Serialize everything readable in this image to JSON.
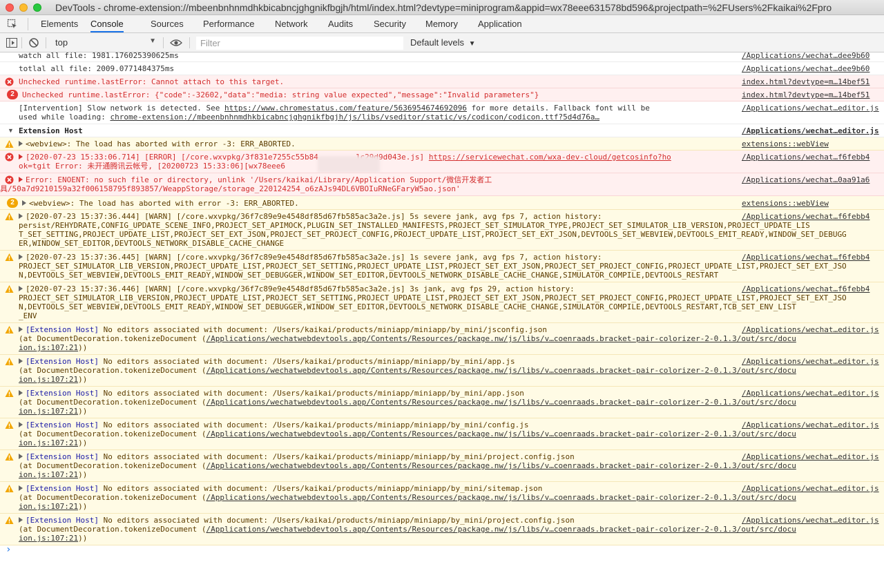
{
  "window": {
    "title": "DevTools - chrome-extension://mbeenbnhnmdhkbicabncjghgnikfbgjh/html/index.html?devtype=miniprogram&appid=wx78eee631578bd596&projectpath=%2FUsers%2Fkaikai%2Fpro"
  },
  "tabs": [
    "Elements",
    "Console",
    "Sources",
    "Performance",
    "Network",
    "Audits",
    "Security",
    "Memory",
    "Application"
  ],
  "active_tab": "Console",
  "toolbar": {
    "context": "top",
    "filter_placeholder": "Filter",
    "levels": "Default levels"
  },
  "colors": {
    "error": "#d32f2f",
    "warn": "#f2a600",
    "accent": "#1a73e8",
    "link_blue": "#1a1aa6"
  },
  "messages": {
    "m0": {
      "line1": "watch all file: 1981.176025390625ms",
      "src": "/Applications/wechat…dee9b60"
    },
    "m1": {
      "line1": "totlal all file: 2009.0771484375ms",
      "src": "/Applications/wechat…dee9b60"
    },
    "m2": {
      "line1": "Unchecked runtime.lastError: Cannot attach to this target.",
      "src": "index.html?devtype=m…14bef51"
    },
    "m3": {
      "badge": "2",
      "line1": "Unchecked runtime.lastError: {\"code\":-32602,\"data\":\"media: string value expected\",\"message\":\"Invalid parameters\"}",
      "src": "index.html?devtype=m…14bef51"
    },
    "m4": {
      "line1_pre": "[Intervention] Slow network is detected. See ",
      "line1_link": "https://www.chromestatus.com/feature/5636954674692096",
      "line1_post": " for more details. Fallback font will be",
      "line2_pre": "used while loading: ",
      "line2_link": "chrome-extension://mbeenbnhnmdhkbicabncjghgnikfbgjh/js/libs/vseditor/static/vs/codicon/codicon.ttf?5d4d76a…",
      "src": "/Applications/wechat…editor.js"
    },
    "m5": {
      "label": "Extension Host",
      "src": "/Applications/wechat…editor.js"
    },
    "m6": {
      "line1": "<webview>: The load has aborted with error -3: ERR_ABORTED.",
      "src": "extensions::webView"
    },
    "m7": {
      "line1_pre": "[2020-07-23 15:33:06.714] [ERROR] [/core.wxvpkg/3f831e7255c55b84",
      "line1_mid": "1c29d9d043e.js] ",
      "line1_link": "https://servicewechat.com/wxa-dev-cloud/getcosinfo?ho",
      "line2": "ok=tgit Error: 未开通腾讯云帐号, [20200723 15:33:06][wx78eee6",
      "src": "/Applications/wechat…f6febb4"
    },
    "m8": {
      "line1": "Error: ENOENT: no such file or directory, unlink '/Users/kaikai/Library/Application Support/微信开发者工",
      "line2": "具/50a7d9210159a32f006158795f893857/WeappStorage/storage_220124254_o6zAJs94DL6VBOIuRNeGFaryW5ao.json'",
      "src": "/Applications/wechat…0aa91a6"
    },
    "m9": {
      "badge": "2",
      "line1": "<webview>: The load has aborted with error -3: ERR_ABORTED.",
      "src": "extensions::webView"
    },
    "m10": {
      "line1": "[2020-07-23 15:37:36.444] [WARN] [/core.wxvpkg/36f7c89e9e4548df85d67fb585ac3a2e.js] 5s severe jank, avg fps 7, action history:",
      "line2": "persist/REHYDRATE,CONFIG_UPDATE_SCENE_INFO,PROJECT_SET_APIMOCK,PLUGIN_SET_INSTALLED_MANIFESTS,PROJECT_SET_SIMULATOR_TYPE,PROJECT_SET_SIMULATOR_LIB_VERSION,PROJECT_UPDATE_LIS",
      "line3": "T_SET_SETTING,PROJECT_UPDATE_LIST,PROJECT_SET_EXT_JSON,PROJECT_SET_PROJECT_CONFIG,PROJECT_UPDATE_LIST,PROJECT_SET_EXT_JSON,DEVTOOLS_SET_WEBVIEW,DEVTOOLS_EMIT_READY,WINDOW_SET_DEBUGG",
      "line4": "ER,WINDOW_SET_EDITOR,DEVTOOLS_NETWORK_DISABLE_CACHE_CHANGE",
      "src": "/Applications/wechat…f6febb4"
    },
    "m11": {
      "line1": "[2020-07-23 15:37:36.445] [WARN] [/core.wxvpkg/36f7c89e9e4548df85d67fb585ac3a2e.js] 1s severe jank, avg fps 7, action history:",
      "line2": "PROJECT_SET_SIMULATOR_LIB_VERSION,PROJECT_UPDATE_LIST,PROJECT_SET_SETTING,PROJECT_UPDATE_LIST,PROJECT_SET_EXT_JSON,PROJECT_SET_PROJECT_CONFIG,PROJECT_UPDATE_LIST,PROJECT_SET_EXT_JSO",
      "line3": "N,DEVTOOLS_SET_WEBVIEW,DEVTOOLS_EMIT_READY,WINDOW_SET_DEBUGGER,WINDOW_SET_EDITOR,DEVTOOLS_NETWORK_DISABLE_CACHE_CHANGE,SIMULATOR_COMPILE,DEVTOOLS_RESTART",
      "src": "/Applications/wechat…f6febb4"
    },
    "m12": {
      "line1": "[2020-07-23 15:37:36.446] [WARN] [/core.wxvpkg/36f7c89e9e4548df85d67fb585ac3a2e.js] 3s jank, avg fps 29, action history:",
      "line2": "PROJECT_SET_SIMULATOR_LIB_VERSION,PROJECT_UPDATE_LIST,PROJECT_SET_SETTING,PROJECT_UPDATE_LIST,PROJECT_SET_EXT_JSON,PROJECT_SET_PROJECT_CONFIG,PROJECT_UPDATE_LIST,PROJECT_SET_EXT_JSO",
      "line3": "N,DEVTOOLS_SET_WEBVIEW,DEVTOOLS_EMIT_READY,WINDOW_SET_DEBUGGER,WINDOW_SET_EDITOR,DEVTOOLS_NETWORK_DISABLE_CACHE_CHANGE,SIMULATOR_COMPILE,DEVTOOLS_RESTART,TCB_SET_ENV_LIST",
      "line4": "_ENV",
      "src": "/Applications/wechat…f6febb4"
    },
    "ext_prefix": "[Extension Host]",
    "ext_line2_pre": "(at DocumentDecoration.tokenizeDocument (",
    "ext_line2_link": "/Applications/wechatwebdevtools.app/Contents/Resources/package.nw/js/libs/v…coenraads.bracket-pair-colorizer-2-0.1.3/out/src/docu",
    "ext_line3_link": "ion.js:107:21",
    "ext_line3_post": "))",
    "ext_src": "/Applications/wechat…editor.js",
    "m13": {
      "line1": " No editors associated with document: /Users/kaikai/products/miniapp/miniapp/by_mini/jsconfig.json"
    },
    "m14": {
      "line1": " No editors associated with document: /Users/kaikai/products/miniapp/miniapp/by_mini/app.js"
    },
    "m15": {
      "line1": " No editors associated with document: /Users/kaikai/products/miniapp/miniapp/by_mini/app.json"
    },
    "m16": {
      "line1": " No editors associated with document: /Users/kaikai/products/miniapp/miniapp/by_mini/config.js"
    },
    "m17": {
      "line1": " No editors associated with document: /Users/kaikai/products/miniapp/miniapp/by_mini/project.config.json"
    },
    "m18": {
      "line1": " No editors associated with document: /Users/kaikai/products/miniapp/miniapp/by_mini/sitemap.json"
    },
    "m19": {
      "line1": " No editors associated with document: /Users/kaikai/products/miniapp/miniapp/by_mini/project.config.json"
    },
    "prompt": "›"
  }
}
